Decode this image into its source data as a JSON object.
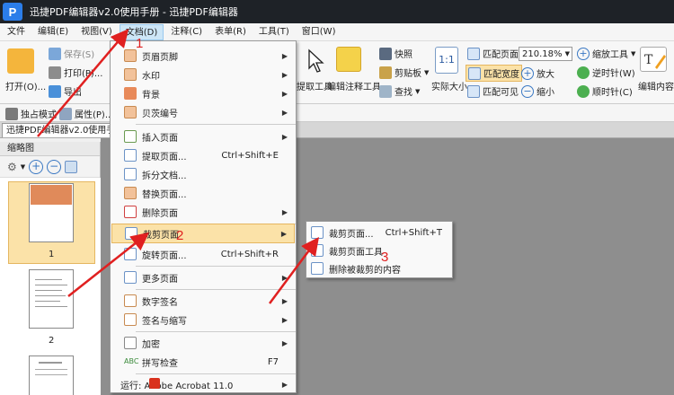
{
  "titlebar": {
    "logo": "P",
    "title": "迅捷PDF编辑器v2.0使用手册 - 迅捷PDF编辑器"
  },
  "menubar": {
    "items": [
      "文件",
      "编辑(E)",
      "视图(V)",
      "文档(D)",
      "注释(C)",
      "表单(R)",
      "工具(T)",
      "窗口(W)"
    ]
  },
  "toolbar": {
    "open": "打开(O)...",
    "save": "保存(S)",
    "print": "打印(P)...",
    "export": "导出",
    "extract_tool": "提取工具",
    "edit_annot_tool": "编辑注释工具",
    "snapshot": "快照",
    "clipboard": "剪贴板",
    "find": "查找",
    "actual_size": "实际大小",
    "fit_page": "匹配页面",
    "fit_width": "匹配宽度",
    "fit_visible": "匹配可见",
    "zoom_value": "210.18%",
    "zoom_tool": "缩放工具",
    "zoom_in": "放大",
    "zoom_out": "缩小",
    "rotate_ccw": "逆时针(W)",
    "rotate_cw": "顺时针(C)",
    "edit_content": "编辑内容",
    "exclusive_mode": "独占模式",
    "properties": "属性(P)..."
  },
  "doc_tab": {
    "title": "迅捷PDF编辑器v2.0使用手册"
  },
  "sidepanel": {
    "title": "缩略图",
    "page1": "1",
    "page2": "2"
  },
  "dropdown": {
    "items": [
      {
        "label": "页眉页脚",
        "shortcut": "",
        "arrow": "▶"
      },
      {
        "label": "水印",
        "shortcut": "",
        "arrow": "▶"
      },
      {
        "label": "背景",
        "shortcut": "",
        "arrow": "▶"
      },
      {
        "label": "贝茨编号",
        "shortcut": "",
        "arrow": "▶"
      },
      {
        "label": "插入页面",
        "shortcut": "",
        "arrow": "▶"
      },
      {
        "label": "提取页面...",
        "shortcut": "Ctrl+Shift+E",
        "arrow": ""
      },
      {
        "label": "拆分文档...",
        "shortcut": "",
        "arrow": ""
      },
      {
        "label": "替换页面...",
        "shortcut": "",
        "arrow": ""
      },
      {
        "label": "删除页面",
        "shortcut": "",
        "arrow": "▶"
      },
      {
        "label": "裁剪页面",
        "shortcut": "",
        "arrow": "▶"
      },
      {
        "label": "旋转页面...",
        "shortcut": "Ctrl+Shift+R",
        "arrow": ""
      },
      {
        "label": "更多页面",
        "shortcut": "",
        "arrow": "▶"
      },
      {
        "label": "数字签名",
        "shortcut": "",
        "arrow": "▶"
      },
      {
        "label": "签名与缩写",
        "shortcut": "",
        "arrow": "▶"
      },
      {
        "label": "加密",
        "shortcut": "",
        "arrow": "▶"
      },
      {
        "label": "拼写检查",
        "shortcut": "F7",
        "arrow": ""
      },
      {
        "label": "运行: Adobe Acrobat 11.0",
        "shortcut": "",
        "arrow": "▶"
      }
    ]
  },
  "submenu": {
    "items": [
      {
        "label": "裁剪页面...",
        "shortcut": "Ctrl+Shift+T"
      },
      {
        "label": "裁剪页面工具",
        "shortcut": ""
      },
      {
        "label": "删除被裁剪的内容",
        "shortcut": ""
      }
    ]
  },
  "annotations": {
    "step1": "1",
    "step2": "2",
    "step3": "3"
  },
  "colors": {
    "highlight": "#fbe2a8",
    "arrow": "#e02020",
    "titlebar": "#1e2227"
  }
}
